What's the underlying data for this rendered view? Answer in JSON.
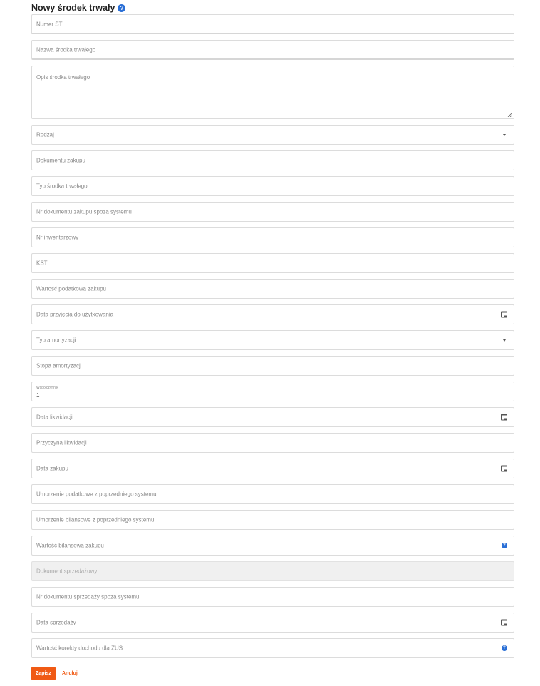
{
  "form": {
    "title": "Nowy środek trwały",
    "fields": {
      "numer_st": "Numer ŚT",
      "nazwa": "Nazwa środka trwałego",
      "opis": "Opis środka trwałego",
      "rodzaj": "Rodzaj",
      "dokument_zakupu": "Dokumentu zakupu",
      "typ_srodka": "Typ środka trwałego",
      "nr_dok_zakupu_spoza": "Nr dokumentu zakupu spoza systemu",
      "nr_inwentarzowy": "Nr inwentarzowy",
      "kst": "KST",
      "wartosc_podatkowa": "Wartość podatkowa zakupu",
      "data_przyjecia": "Data przyjęcia do użytkowania",
      "typ_amortyzacji": "Typ amortyzacji",
      "stopa_amortyzacji": "Stopa amortyzacji",
      "wspolczynnik_label": "Współczynnik",
      "wspolczynnik_value": "1",
      "data_likwidacji": "Data likwidacji",
      "przyczyna_likwidacji": "Przyczyna likwidacji",
      "data_zakupu": "Data zakupu",
      "umorzenie_podatkowe": "Umorzenie podatkowe z poprzedniego systemu",
      "umorzenie_bilansowe": "Umorzenie bilansowe z poprzedniego systemu",
      "wartosc_bilansowa": "Wartość bilansowa zakupu",
      "dokument_sprzedazowy": "Dokument sprzedażowy",
      "nr_dok_sprzedazy_spoza": "Nr dokumentu sprzedaży spoza systemu",
      "data_sprzedazy": "Data sprzedaży",
      "wartosc_korekty_zus": "Wartość korekty dochodu dla ZUS"
    },
    "actions": {
      "save": "Zapisz",
      "cancel": "Anuluj"
    }
  },
  "icons": {
    "help": "question-circle-icon",
    "calendar": "calendar-icon",
    "dropdown": "chevron-down-icon"
  },
  "colors": {
    "accent": "#f05a14",
    "help": "#2a6fd6"
  }
}
